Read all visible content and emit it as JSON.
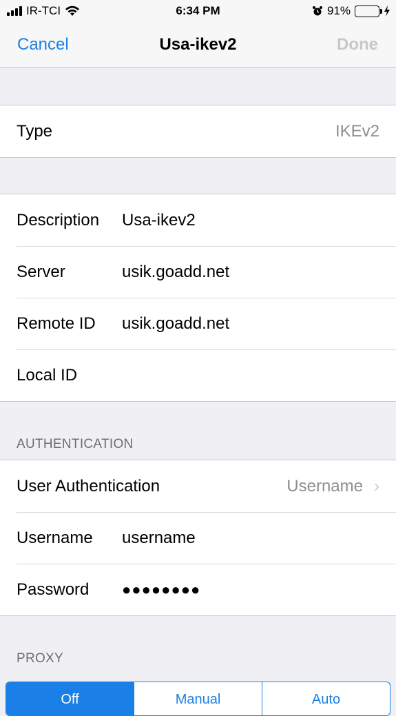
{
  "status_bar": {
    "carrier": "IR-TCI",
    "time": "6:34 PM",
    "battery_percent": "91%",
    "battery_level": 0.91
  },
  "nav": {
    "cancel": "Cancel",
    "title": "Usa-ikev2",
    "done": "Done"
  },
  "type_row": {
    "label": "Type",
    "value": "IKEv2"
  },
  "connection": {
    "description": {
      "label": "Description",
      "value": "Usa-ikev2"
    },
    "server": {
      "label": "Server",
      "value": "usik.goadd.net"
    },
    "remote_id": {
      "label": "Remote ID",
      "value": "usik.goadd.net"
    },
    "local_id": {
      "label": "Local ID",
      "value": ""
    }
  },
  "authentication": {
    "header": "AUTHENTICATION",
    "user_auth": {
      "label": "User Authentication",
      "value": "Username"
    },
    "username": {
      "label": "Username",
      "value": "username"
    },
    "password": {
      "label": "Password",
      "value": "●●●●●●●●"
    }
  },
  "proxy": {
    "header": "PROXY",
    "options": [
      "Off",
      "Manual",
      "Auto"
    ],
    "selected": "Off"
  },
  "colors": {
    "accent": "#1a7fe6",
    "battery": "#4cd964",
    "disabled": "#c7c7cc"
  }
}
